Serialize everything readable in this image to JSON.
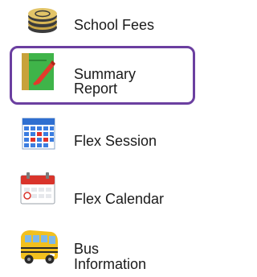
{
  "menu": {
    "items": [
      {
        "label_lines": [
          "School Fees"
        ],
        "icon": "coins-icon"
      },
      {
        "label_lines": [
          "Summary",
          "Report"
        ],
        "icon": "summary-report-icon",
        "highlighted": true
      },
      {
        "label_lines": [
          "Flex Session"
        ],
        "icon": "grid-calendar-icon"
      },
      {
        "label_lines": [
          "Flex Calendar"
        ],
        "icon": "calendar-icon"
      },
      {
        "label_lines": [
          "Bus",
          "Information"
        ],
        "icon": "school-bus-icon"
      }
    ]
  },
  "colors": {
    "highlight_border": "#6b3fa0",
    "text": "#1a1a1a"
  }
}
